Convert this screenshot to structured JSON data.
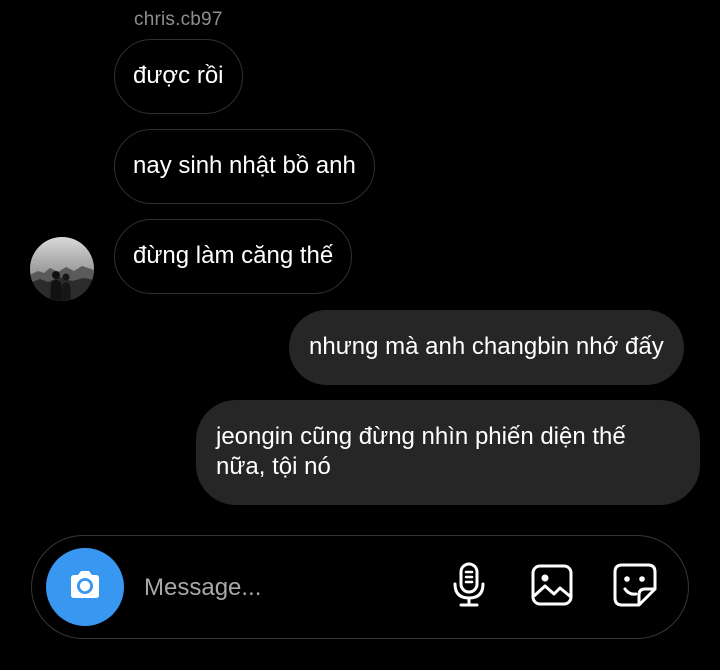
{
  "thread": {
    "sender_name": "chris.cb97",
    "incoming": [
      {
        "text": "được rồi"
      },
      {
        "text": "nay sinh nhật bồ anh"
      },
      {
        "text": "đừng làm căng thế"
      }
    ],
    "outgoing": [
      {
        "text": "nhưng mà anh changbin nhớ đấy"
      },
      {
        "text": "jeongin cũng đừng nhìn phiến diện thế nữa, tội nó"
      }
    ]
  },
  "composer": {
    "placeholder": "Message...",
    "value": "",
    "icons": {
      "camera": "camera-icon",
      "mic": "microphone-icon",
      "gallery": "image-icon",
      "sticker": "sticker-icon"
    }
  },
  "colors": {
    "background": "#000000",
    "outgoing_bubble": "#262626",
    "incoming_border": "#2f2f2f",
    "accent": "#3897f0",
    "muted_text": "#8e8e8e"
  }
}
